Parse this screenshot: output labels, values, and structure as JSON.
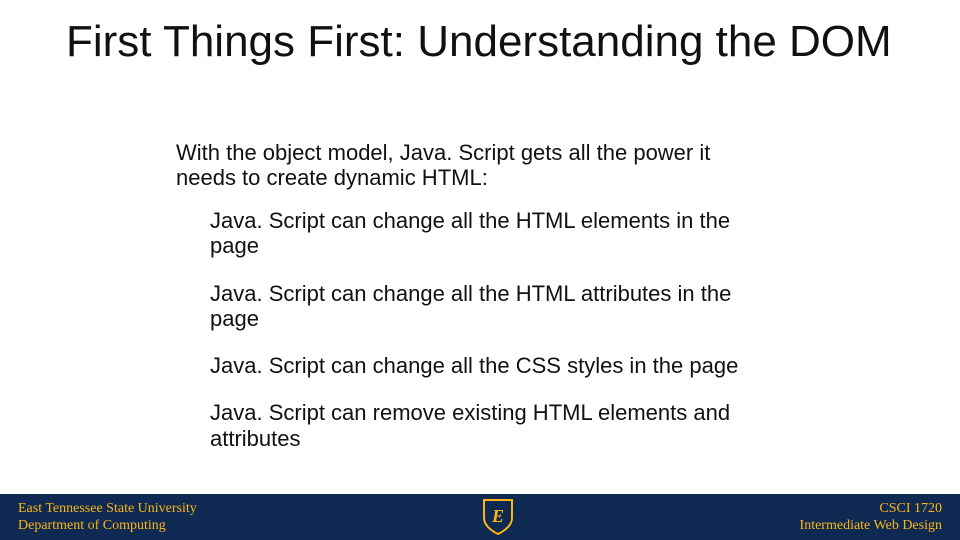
{
  "slide": {
    "title": "First Things First: Understanding the DOM",
    "intro": "With the object model, Java. Script gets all the power it needs to create dynamic HTML:",
    "bullets": [
      "Java. Script can change all the HTML elements in the page",
      "Java. Script can change all the HTML attributes in the page",
      "Java. Script can change all the CSS styles in the page",
      "Java. Script can remove existing HTML elements and attributes"
    ]
  },
  "footer": {
    "left_line1": "East Tennessee State University",
    "left_line2": "Department of Computing",
    "right_line1": "CSCI 1720",
    "right_line2": "Intermediate Web Design",
    "shield_letter": "E",
    "colors": {
      "bg": "#0e2a52",
      "gold": "#fdb515"
    }
  }
}
